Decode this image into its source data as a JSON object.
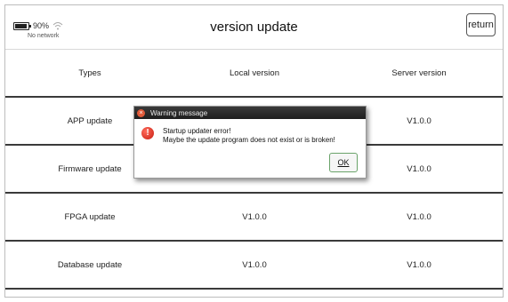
{
  "status": {
    "battery_percent": "90%",
    "battery_level": 0.9,
    "network_text": "No network",
    "wifi_icon": "wifi-icon",
    "battery_icon": "battery-icon"
  },
  "header": {
    "title": "version update",
    "return_label": "return"
  },
  "table": {
    "columns": [
      "Types",
      "Local version",
      "Server version"
    ],
    "rows": [
      {
        "type": "APP update",
        "local": "",
        "server": "V1.0.0"
      },
      {
        "type": "Firmware update",
        "local": "",
        "server": "V1.0.0"
      },
      {
        "type": "FPGA update",
        "local": "V1.0.0",
        "server": "V1.0.0"
      },
      {
        "type": "Database update",
        "local": "V1.0.0",
        "server": "V1.0.0"
      }
    ]
  },
  "dialog": {
    "title": "Warning message",
    "close_icon": "close-icon",
    "error_icon": "error-icon",
    "message_line1": "Startup updater error!",
    "message_line2": "Maybe the update program does not exist or is broken!",
    "ok_label": "OK"
  }
}
